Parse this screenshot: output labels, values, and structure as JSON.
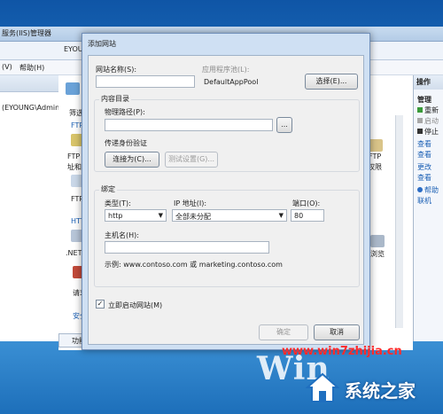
{
  "background": {
    "main_window_title": "服务(IIS)管理器",
    "breadcrumb": [
      "EYOUNG",
      "▸"
    ],
    "menu": [
      "(V)",
      "帮助(H)"
    ],
    "left_node": "(EYOUNG\\Admin",
    "center_fragments": {
      "filter": "筛选",
      "ftp1": "FTP",
      "ftp2": "FTP",
      "ftp3": "址和",
      "ftp4": "FTP",
      "http": "HTT",
      "net": ".NET",
      "request": "请求",
      "security": "安全",
      "ftp_right": "FTP",
      "perm": "权限",
      "browse": "浏览",
      "bottom_tab": "功能"
    },
    "actions_pane": {
      "title": "操作",
      "manage": "管理",
      "items": [
        "重新",
        "启动",
        "停止",
        "查看",
        "查看",
        "更改",
        "查看",
        "帮助",
        "联机"
      ]
    }
  },
  "dialog": {
    "title": "添加网站",
    "site_name_label": "网站名称(S):",
    "site_name_value": "",
    "app_pool_label": "应用程序池(L):",
    "app_pool_value": "DefaultAppPool",
    "select_button": "选择(E)...",
    "content_dir_group": "内容目录",
    "physical_path_label": "物理路径(P):",
    "physical_path_value": "",
    "browse_button": "...",
    "passthrough_label": "传递身份验证",
    "connect_as_button": "连接为(C)...",
    "test_settings_button": "测试设置(G)...",
    "binding_group": "绑定",
    "type_label": "类型(T):",
    "type_value": "http",
    "ip_label": "IP 地址(I):",
    "ip_value": "全部未分配",
    "port_label": "端口(O):",
    "port_value": "80",
    "hostname_label": "主机名(H):",
    "hostname_value": "",
    "example_text": "示例: www.contoso.com 或 marketing.contoso.com",
    "start_immediately_label": "立即启动网站(M)",
    "start_immediately_checked": true,
    "ok_button": "确定",
    "cancel_button": "取消"
  },
  "watermark": {
    "site": "www.win7zhijia.cn",
    "os_logo": "Win",
    "brand": "系统之家"
  }
}
